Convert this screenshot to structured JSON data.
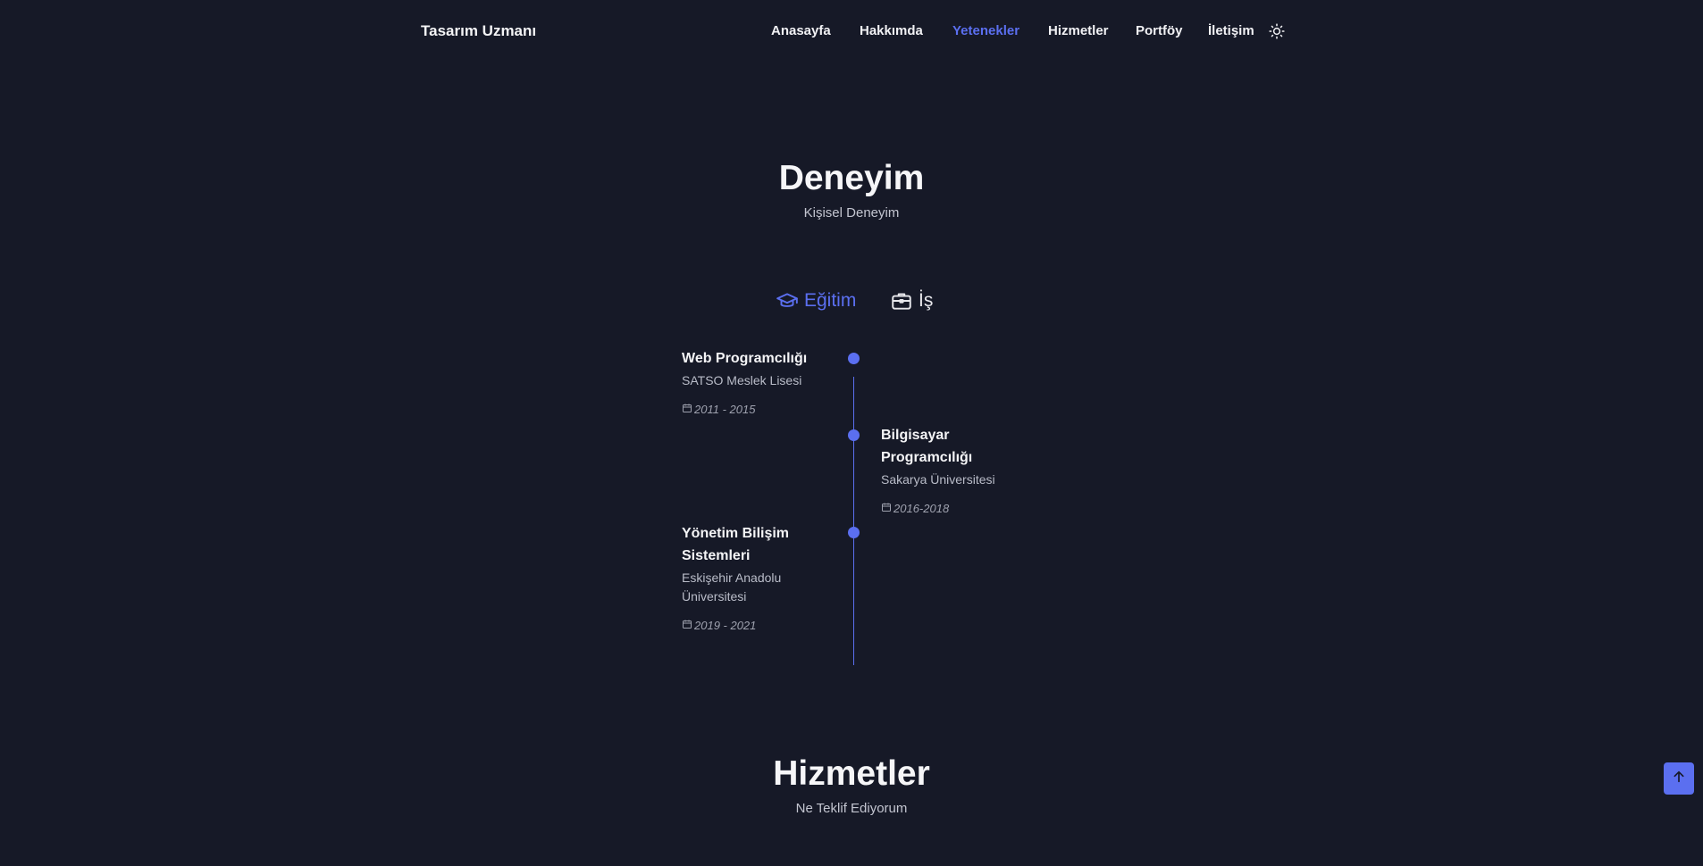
{
  "header": {
    "logo": "Tasarım Uzmanı",
    "nav": [
      {
        "label": "Anasayfa",
        "active": false
      },
      {
        "label": "Hakkımda",
        "active": false
      },
      {
        "label": "Yetenekler",
        "active": true
      },
      {
        "label": "Hizmetler",
        "active": false
      },
      {
        "label": "Portföy",
        "active": false
      },
      {
        "label": "İletişim",
        "active": false
      }
    ],
    "theme_icon": "sun-icon"
  },
  "experience": {
    "title": "Deneyim",
    "subtitle": "Kişisel Deneyim",
    "tabs": [
      {
        "label": "Eğitim",
        "icon": "graduation-cap-icon",
        "active": true
      },
      {
        "label": "İş",
        "icon": "briefcase-icon",
        "active": false
      }
    ],
    "items": [
      {
        "title": "Web Programcılığı",
        "school": "SATSO Meslek Lisesi",
        "date": "2011 - 2015"
      },
      {
        "title": "Bilgisayar Programcılığı",
        "school": "Sakarya Üniversitesi",
        "date": "2016-2018"
      },
      {
        "title": "Yönetim Bilişim Sistemleri",
        "school": "Eskişehir Anadolu Üniversitesi",
        "date": "2019 - 2021"
      }
    ]
  },
  "services": {
    "title": "Hizmetler",
    "subtitle": "Ne Teklif Ediyorum"
  },
  "scroll_top_icon": "arrow-up-icon",
  "colors": {
    "background": "#161927",
    "accent": "#5b6ff0",
    "text": "#f1f1f4",
    "muted": "#b9bcc8"
  }
}
